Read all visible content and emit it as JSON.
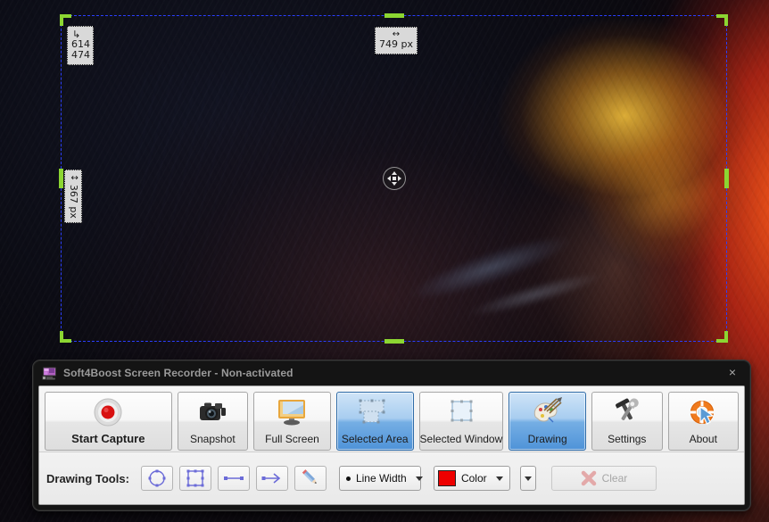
{
  "desktop": {
    "wallpaper_name": "fiery-nebula-wallpaper"
  },
  "selection_overlay": {
    "position_badge": {
      "glyph": "↳",
      "x": "614",
      "y": "474"
    },
    "width_badge": {
      "glyph": "↔",
      "text": "749 px"
    },
    "height_badge": {
      "glyph": "↕",
      "text": "367 px"
    },
    "move_handle_name": "move-selection-handle",
    "border_color": "#2b3fff",
    "handle_color": "#8cd632"
  },
  "window": {
    "title": "Soft4Boost Screen Recorder - Non-activated",
    "close_label": "×",
    "app_icon": "monitor-icon"
  },
  "toolbar": {
    "buttons": [
      {
        "label": "Start Capture",
        "icon": "record-icon",
        "active": false
      },
      {
        "label": "Snapshot",
        "icon": "camera-icon",
        "active": false
      },
      {
        "label": "Full Screen",
        "icon": "monitor-icon",
        "active": false
      },
      {
        "label": "Selected Area",
        "icon": "selected-area-icon",
        "active": true
      },
      {
        "label": "Selected Window",
        "icon": "selected-window-icon",
        "active": false
      },
      {
        "label": "Drawing",
        "icon": "palette-icon",
        "active": true
      },
      {
        "label": "Settings",
        "icon": "wrench-hammer-icon",
        "active": false
      },
      {
        "label": "About",
        "icon": "lifering-icon",
        "active": false
      }
    ]
  },
  "drawing_tools": {
    "label": "Drawing Tools:",
    "tools": [
      {
        "name": "ellipse-tool",
        "icon": "circle-icon"
      },
      {
        "name": "rectangle-tool",
        "icon": "rectangle-icon"
      },
      {
        "name": "line-tool",
        "icon": "line-icon"
      },
      {
        "name": "arrow-tool",
        "icon": "arrow-icon"
      },
      {
        "name": "pencil-tool",
        "icon": "pencil-icon"
      }
    ],
    "line_width": {
      "label": "Line Width"
    },
    "color": {
      "label": "Color",
      "value": "#ee0000"
    },
    "clear": {
      "label": "Clear",
      "enabled": false
    }
  }
}
